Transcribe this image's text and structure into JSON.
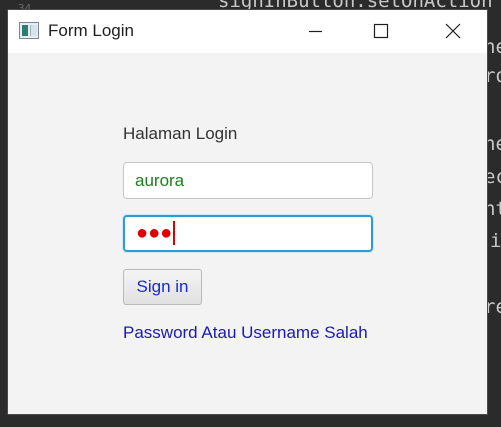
{
  "background_code": {
    "line_number": "34",
    "lines": [
      "signInButton.setOnAction",
      "ne",
      "ro",
      "ne",
      "ec",
      "nt",
      "i",
      "re"
    ]
  },
  "window": {
    "title": "Form Login",
    "icon": "java-app-icon",
    "controls": {
      "minimize": "minimize-icon",
      "maximize": "maximize-icon",
      "close": "close-icon"
    }
  },
  "form": {
    "heading": "Halaman Login",
    "username_value": "aurora",
    "password_mask": "●●●",
    "signin_label": "Sign in",
    "message": "Password Atau Username Salah"
  },
  "colors": {
    "message": "#1a1ab5",
    "username_text": "#1e7d1e",
    "password_text": "#e00000",
    "focus_border": "#2e9bd6"
  }
}
